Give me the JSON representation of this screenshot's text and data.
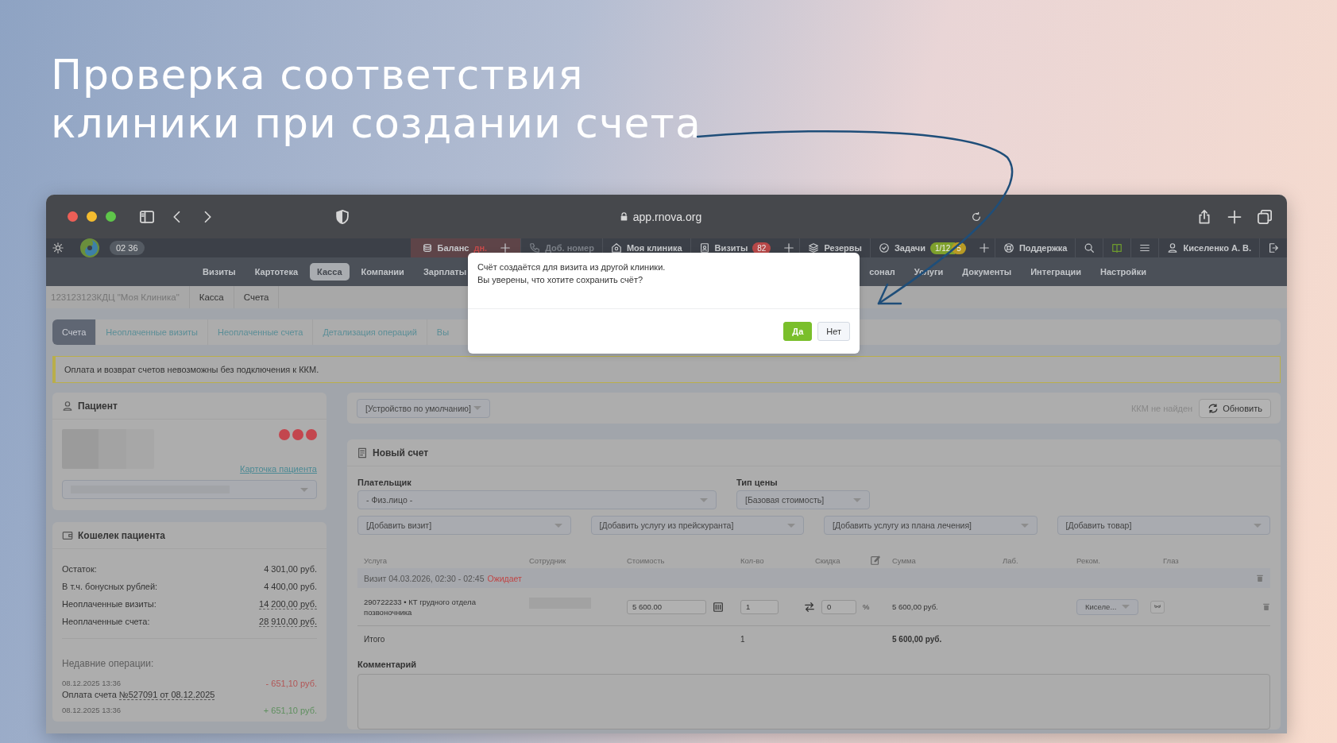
{
  "headline": "Проверка соответствия клиники при создании счета",
  "browser": {
    "address": "app.rnova.org"
  },
  "app_header": {
    "time": "02 36",
    "items": [
      {
        "kind": "balance",
        "label": "Баланс",
        "note": "дн."
      },
      {
        "kind": "plus"
      },
      {
        "kind": "phone",
        "label": "Доб. номер",
        "disabled": true
      },
      {
        "kind": "clinic",
        "label": "Моя клиника",
        "disabled": false
      },
      {
        "kind": "visits",
        "label": "Визиты",
        "badges": [
          "82"
        ]
      },
      {
        "kind": "plus"
      },
      {
        "kind": "reserves",
        "label": "Резервы"
      },
      {
        "kind": "tasks",
        "label": "Задачи",
        "badges": [
          "1/12",
          "5"
        ]
      },
      {
        "kind": "plus"
      },
      {
        "kind": "support",
        "label": "Поддержка"
      },
      {
        "kind": "search"
      },
      {
        "kind": "book"
      },
      {
        "kind": "menu"
      },
      {
        "kind": "user",
        "label": "Киселенко А. В."
      },
      {
        "kind": "logout"
      }
    ]
  },
  "nav": {
    "left_items": [
      {
        "label": "Визиты",
        "selected": false
      },
      {
        "label": "Картотека",
        "selected": false
      },
      {
        "label": "Касса",
        "selected": true
      },
      {
        "label": "Компании",
        "selected": false
      },
      {
        "label": "Зарплаты",
        "selected": false
      }
    ],
    "right_items": [
      {
        "label": "сонал",
        "selected": false
      },
      {
        "label": "Услуги",
        "selected": false
      },
      {
        "label": "Документы",
        "selected": false
      },
      {
        "label": "Интеграции",
        "selected": false
      },
      {
        "label": "Настройки",
        "selected": false
      }
    ]
  },
  "breadcrumbs": [
    {
      "label": "123123123КДЦ \"Моя Клиника\"",
      "kind": "root"
    },
    {
      "label": "Касса",
      "kind": "page"
    },
    {
      "label": "Счета",
      "kind": "page"
    }
  ],
  "tabs": [
    {
      "label": "Счета",
      "selected": true
    },
    {
      "label": "Неоплаченные визиты",
      "selected": false
    },
    {
      "label": "Неоплаченные счета",
      "selected": false
    },
    {
      "label": "Детализация операций",
      "selected": false
    },
    {
      "label": "Вы",
      "selected": false
    }
  ],
  "warning": "Оплата и возврат счетов невозможны без подключения к ККМ.",
  "patient": {
    "title": "Пациент",
    "card_link": "Карточка пациента"
  },
  "wallet": {
    "title": "Кошелек пациента",
    "rows": [
      {
        "label": "Остаток:",
        "value": "4 301,00 руб.",
        "link": false
      },
      {
        "label": "В т.ч. бонусных рублей:",
        "value": "4 400,00 руб.",
        "link": false
      },
      {
        "label": "Неоплаченные визиты:",
        "value": "14 200,00 руб.",
        "link": true
      },
      {
        "label": "Неоплаченные счета:",
        "value": "28 910,00 руб.",
        "link": true
      }
    ],
    "recent_title": "Недавние операции:",
    "operations": [
      {
        "date": "08.12.2025 13:36",
        "amount": "- 651,10 руб.",
        "kind": "debit",
        "text": "Оплата счета ",
        "link": "№527091 от 08.12.2025"
      },
      {
        "date": "08.12.2025 13:36",
        "amount": "+ 651,10 руб.",
        "kind": "credit"
      }
    ]
  },
  "kkm": {
    "device": "[Устройство по умолчанию]",
    "status": "ККМ не найден",
    "refresh": "Обновить"
  },
  "invoice": {
    "title": "Новый счет",
    "payer_label": "Плательщик",
    "payer": "- Физ.лицо -",
    "price_label": "Тип цены",
    "price_type": "[Базовая стоимость]",
    "add_fields": [
      "[Добавить визит]",
      "[Добавить услугу из прейскуранта]",
      "[Добавить услугу из плана лечения]",
      "[Добавить товар]"
    ],
    "columns": [
      "Услуга",
      "Сотрудник",
      "Стоимость",
      "Кол-во",
      "Скидка",
      "Сумма",
      "Лаб.",
      "Реком.",
      "Глаз"
    ],
    "visit": {
      "label": "Визит 04.03.2026, 02:30 - 02:45",
      "status": "Ожидает"
    },
    "services": [
      {
        "name": "290722233 • КТ грудного отдела позвоночника",
        "cost": "5 600.00",
        "quantity": "1",
        "discount": "0",
        "discount_unit": "%",
        "sum": "5 600,00 руб.",
        "recommender": "Киселе..."
      }
    ],
    "total": {
      "label": "Итого",
      "quantity": "1",
      "sum": "5 600,00 руб."
    },
    "comment_label": "Комментарий"
  },
  "dialog": {
    "message": [
      "Счёт создаётся для визита из другой клиники.",
      "Вы уверены, что хотите сохранить счёт?"
    ],
    "buttons": [
      {
        "label": "Да",
        "kind": "primary"
      },
      {
        "label": "Нет",
        "kind": "secondary"
      }
    ]
  }
}
